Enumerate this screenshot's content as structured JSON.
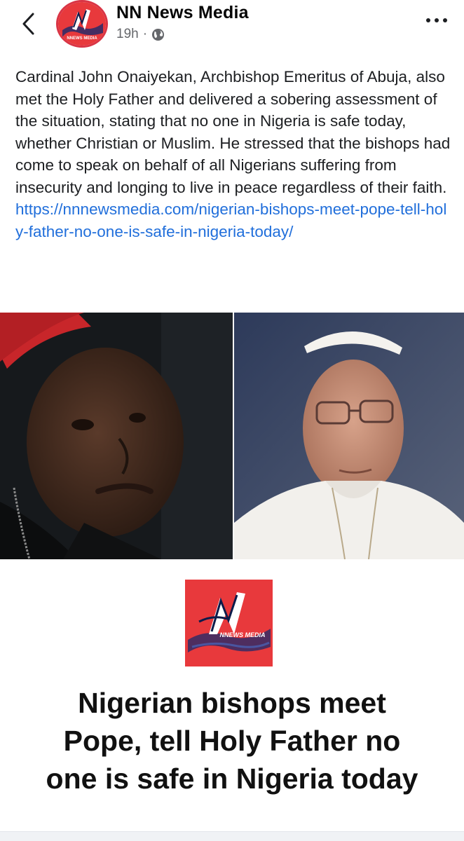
{
  "header": {
    "page_name": "NN News Media",
    "time": "19h",
    "separator": "·",
    "avatar_logo_text": "NNEWS MEDIA"
  },
  "post": {
    "text": "Cardinal John Onaiyekan, Archbishop Emeritus of Abuja, also met the Holy Father and delivered a sobering assessment of the situation, stating that no one in Nigeria is safe today, whether Christian or Muslim. He stressed that the bishops had come to speak on behalf of all Nigerians suffering from insecurity and longing to live in peace regardless of their faith.",
    "link": "https://nnnewsmedia.com/nigerian-bishops-meet-pope-tell-holy-father-no-one-is-safe-in-nigeria-today/"
  },
  "card": {
    "logo_text": "NNEWS MEDIA",
    "headline_line1": "Nigerian bishops meet",
    "headline_line2": "Pope, tell Holy Father no",
    "headline_line3": "one is safe in Nigeria today"
  },
  "colors": {
    "link": "#216fdb",
    "brand_red": "#e8393c",
    "meta_gray": "#65676b"
  },
  "icons": {
    "back": "chevron-left-icon",
    "privacy": "globe-icon",
    "more": "more-dots-icon"
  }
}
